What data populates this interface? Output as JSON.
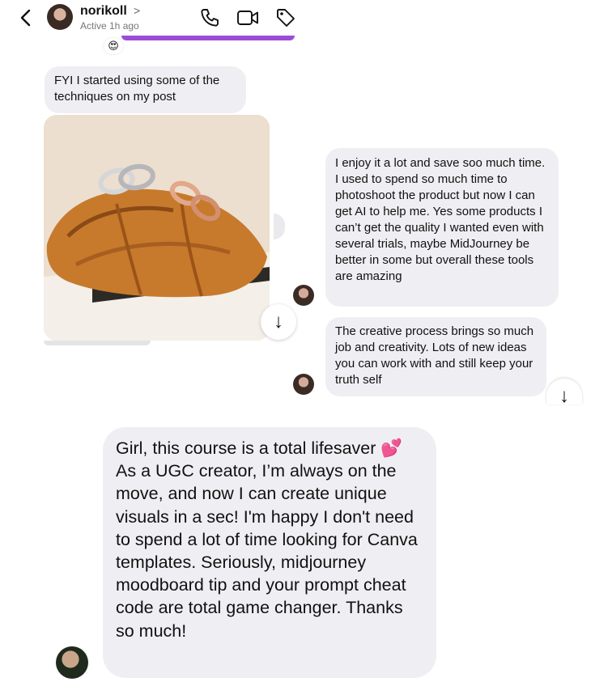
{
  "header": {
    "username": "norikoll",
    "chevron": ">",
    "status": "Active 1h ago",
    "icons": [
      "back-icon",
      "phone-icon",
      "video-icon",
      "tag-icon"
    ]
  },
  "reaction_emoji": "😍",
  "messages": {
    "fyi": "FYI I started using some of the techniques on my post",
    "enjoy": "I enjoy it a lot and save soo much time. I used to spend so much time to photoshoot the product but now I can get AI to help me. Yes some products I can’t get the quality I wanted even with several trials, maybe MidJourney be better in some but overall these tools are amazing",
    "creative": "The creative process brings so much job and creativity. Lots of new ideas you can work with and still keep your truth self",
    "big_part1": "Girl, this course is a total lifesaver",
    "big_heart": "💕",
    "big_part2": " As a UGC creator, I’m always on the move, and now I can create unique visuals in a sec! I'm happy I don't need to spend a lot of time looking for Canva templates. Seriously, midjourney moodboard tip and your prompt cheat code are total game changer. Thanks so much!"
  },
  "scroll_arrow": "↓",
  "colors": {
    "bubble": "#efeff3",
    "accent": "#9b4dd6",
    "heart": "#ff3fa4"
  }
}
